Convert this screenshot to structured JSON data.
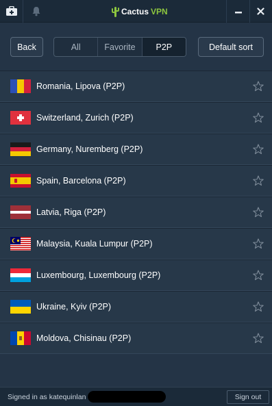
{
  "titlebar": {
    "logo_brand": "Cactus",
    "logo_product": "VPN",
    "icons": [
      "toolbox-icon",
      "bell-icon",
      "minimize-icon",
      "close-icon"
    ]
  },
  "toolbar": {
    "back_label": "Back",
    "filters": [
      "All",
      "Favorite",
      "P2P"
    ],
    "active_filter": "P2P",
    "sort_label": "Default sort"
  },
  "servers": [
    {
      "label": "Romania, Lipova (P2P)",
      "flag": "romania-flag",
      "favorite": false
    },
    {
      "label": "Switzerland, Zurich (P2P)",
      "flag": "switzerland-flag",
      "favorite": false
    },
    {
      "label": "Germany, Nuremberg (P2P)",
      "flag": "germany-flag",
      "favorite": false
    },
    {
      "label": "Spain, Barcelona (P2P)",
      "flag": "spain-flag",
      "favorite": false
    },
    {
      "label": "Latvia, Riga (P2P)",
      "flag": "latvia-flag",
      "favorite": false
    },
    {
      "label": "Malaysia, Kuala Lumpur (P2P)",
      "flag": "malaysia-flag",
      "favorite": false
    },
    {
      "label": "Luxembourg, Luxembourg (P2P)",
      "flag": "luxembourg-flag",
      "favorite": false
    },
    {
      "label": "Ukraine, Kyiv (P2P)",
      "flag": "ukraine-flag",
      "favorite": false
    },
    {
      "label": "Moldova, Chisinau (P2P)",
      "flag": "moldova-flag",
      "favorite": false
    }
  ],
  "footer": {
    "signed_in_text": "Signed in as katequinlan",
    "signout_label": "Sign out"
  },
  "colors": {
    "background": "#243446",
    "titlebar": "#1b2a39",
    "brand_green": "#8dc63f"
  }
}
